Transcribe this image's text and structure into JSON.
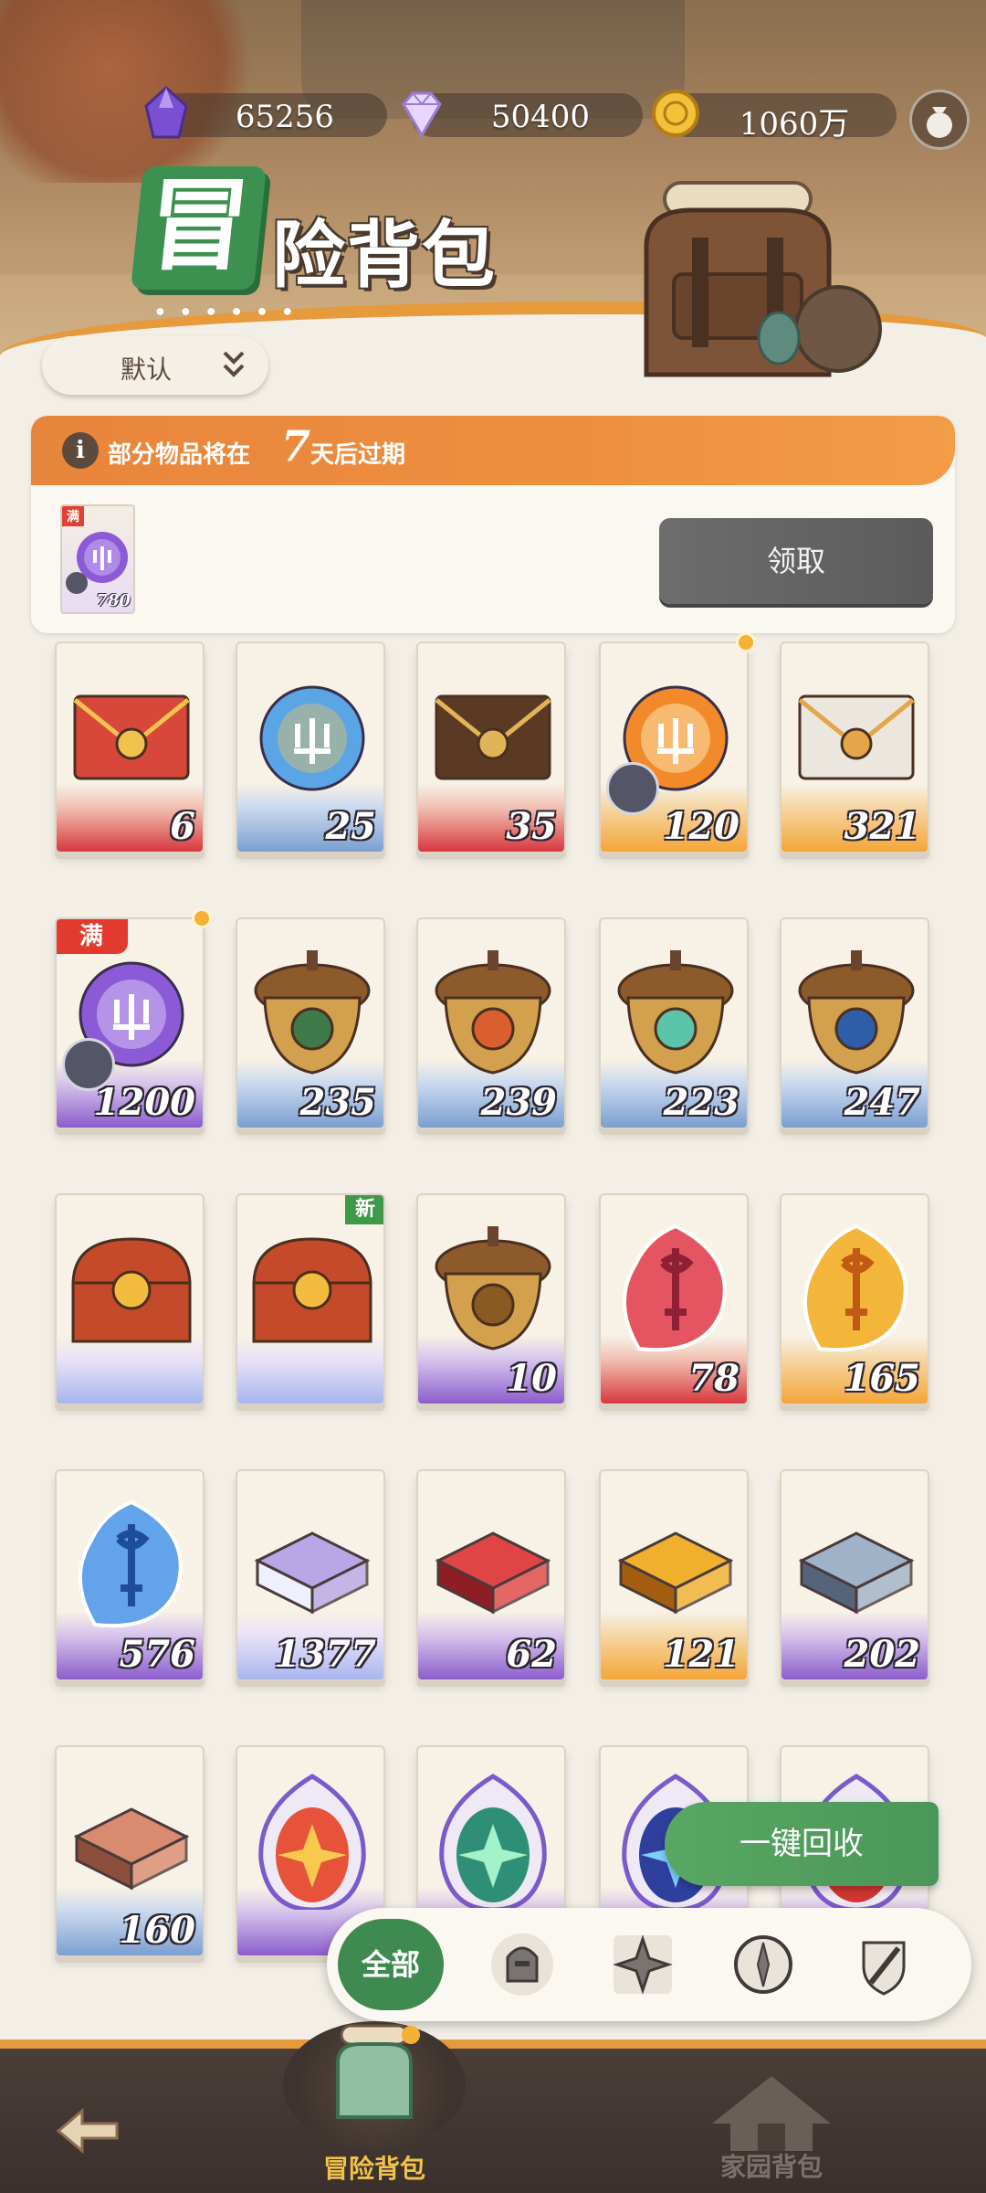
{
  "currency": [
    {
      "icon": "purple-crystal-icon",
      "value": "65256"
    },
    {
      "icon": "diamond-icon",
      "value": "50400"
    },
    {
      "icon": "gold-coin-icon",
      "value": "1060万"
    }
  ],
  "title": {
    "badge": "冒",
    "text": "险背包"
  },
  "sort": {
    "selected": "默认"
  },
  "expire": {
    "text_before": "部分物品将在",
    "days": "7",
    "text_after": "天后过期",
    "item": {
      "badge": "满",
      "count": "780"
    },
    "claim_label": "领取"
  },
  "items": [
    {
      "count": "6",
      "band": "red",
      "art": "red-envelope-icon"
    },
    {
      "count": "25",
      "band": "blue",
      "art": "crystal-orb-icon"
    },
    {
      "count": "35",
      "band": "red",
      "art": "dark-envelope-icon"
    },
    {
      "count": "120",
      "band": "orange",
      "art": "fire-trident-orb-icon",
      "piece": true,
      "dot": true
    },
    {
      "count": "321",
      "band": "orange",
      "art": "white-envelope-icon"
    },
    {
      "count": "1200",
      "band": "purple",
      "art": "purple-trident-orb-icon",
      "piece": true,
      "full": "满",
      "dot": true
    },
    {
      "count": "235",
      "band": "blue",
      "art": "acorn-green-eye-icon"
    },
    {
      "count": "239",
      "band": "blue",
      "art": "acorn-orange-icon"
    },
    {
      "count": "223",
      "band": "blue",
      "art": "acorn-leaf-icon"
    },
    {
      "count": "247",
      "band": "blue",
      "art": "acorn-star-icon"
    },
    {
      "count": "",
      "band": "rainbow",
      "art": "treasure-chest-icon"
    },
    {
      "count": "",
      "band": "rainbow",
      "art": "treasure-chest-icon",
      "new": "新"
    },
    {
      "count": "10",
      "band": "purple",
      "art": "acorn-gold-icon"
    },
    {
      "count": "78",
      "band": "red",
      "art": "red-rune-stone-icon"
    },
    {
      "count": "165",
      "band": "orange",
      "art": "gold-rune-stone-icon"
    },
    {
      "count": "576",
      "band": "purple",
      "art": "blue-rune-stone-icon"
    },
    {
      "count": "1377",
      "band": "rainbow",
      "art": "purple-ingot-icon"
    },
    {
      "count": "62",
      "band": "purple",
      "art": "red-ingot-icon"
    },
    {
      "count": "121",
      "band": "orange",
      "art": "gold-ingot-icon"
    },
    {
      "count": "202",
      "band": "purple",
      "art": "silver-ingot-icon"
    },
    {
      "count": "160",
      "band": "blue",
      "art": "copper-ingot-icon"
    },
    {
      "count": "",
      "band": "purple",
      "art": "fire-egg-emblem-icon"
    },
    {
      "count": "",
      "band": "purple",
      "art": "green-egg-emblem-icon"
    },
    {
      "count": "",
      "band": "purple",
      "art": "blue-egg-emblem-icon"
    },
    {
      "count": "",
      "band": "purple",
      "art": "red-egg-emblem-icon"
    }
  ],
  "recycle_label": "一键回收",
  "filters": {
    "all": "全部",
    "icons": [
      "knight-helmet-icon",
      "shuriken-star-icon",
      "compass-icon",
      "sword-shield-icon"
    ]
  },
  "nav": {
    "adventure": "冒险背包",
    "home": "家园背包"
  },
  "colors": {
    "accent_green": "#3f8a51",
    "accent_orange": "#e69a3c",
    "badge_red": "#e23a2f"
  }
}
